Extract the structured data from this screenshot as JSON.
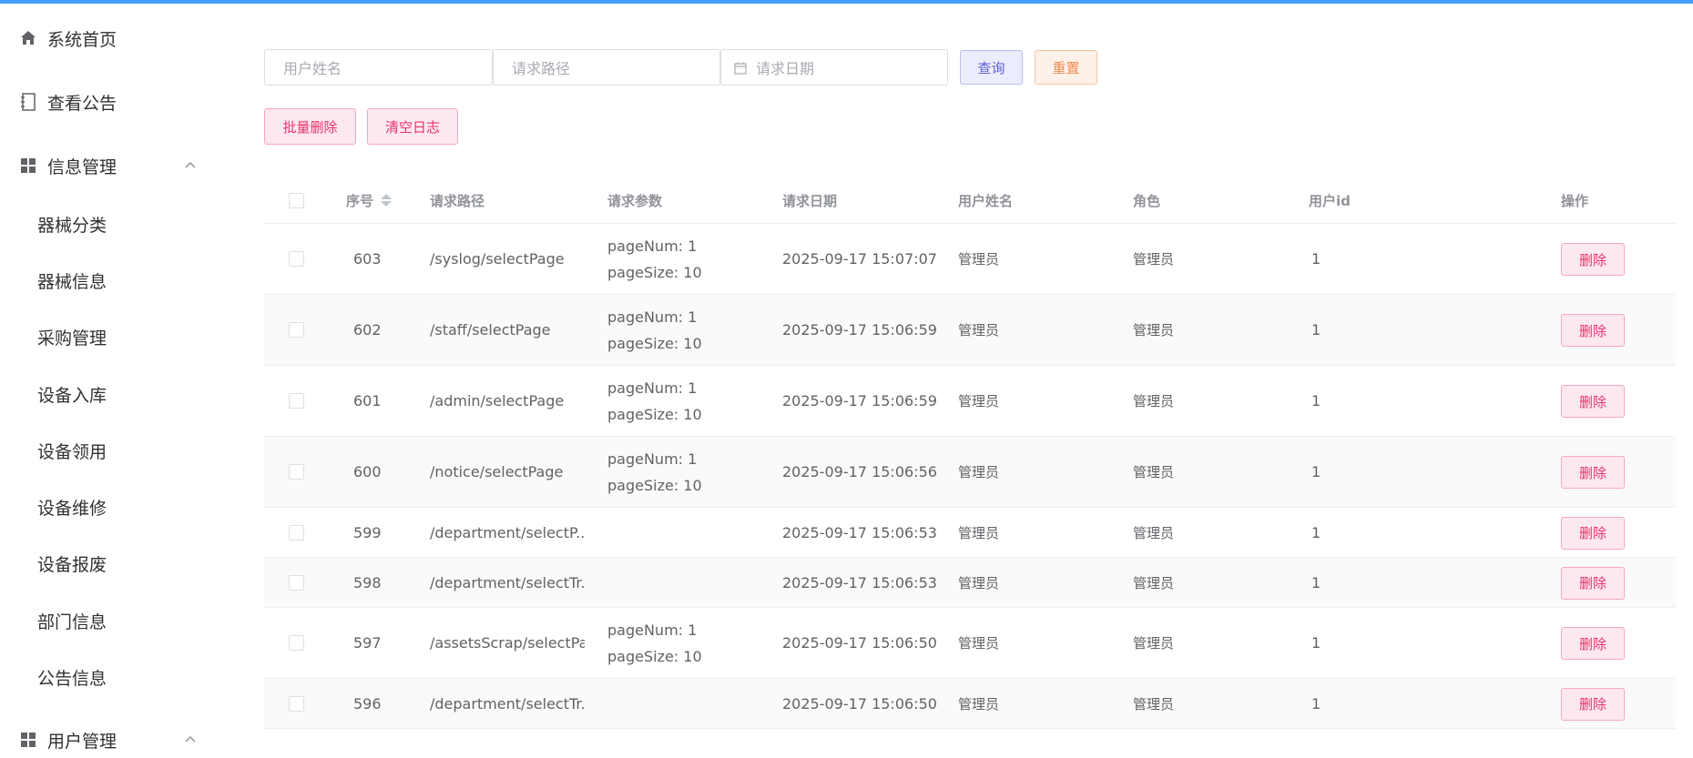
{
  "colors": {
    "accent": "#409eff",
    "danger": "#e8336a",
    "query": "#5b5fd6",
    "reset": "#f08a4b"
  },
  "sidebar": {
    "items": [
      {
        "label": "系统首页",
        "icon": "home-icon"
      },
      {
        "label": "查看公告",
        "icon": "notebook-icon"
      },
      {
        "label": "信息管理",
        "icon": "grid-icon"
      },
      {
        "label": "用户管理",
        "icon": "grid-icon"
      }
    ],
    "sub_items": [
      "器械分类",
      "器械信息",
      "采购管理",
      "设备入库",
      "设备领用",
      "设备维修",
      "设备报废",
      "部门信息",
      "公告信息"
    ]
  },
  "search": {
    "username_placeholder": "用户姓名",
    "path_placeholder": "请求路径",
    "date_placeholder": "请求日期",
    "query_label": "查询",
    "reset_label": "重置"
  },
  "actions": {
    "batch_delete_label": "批量删除",
    "clear_log_label": "清空日志"
  },
  "table": {
    "headers": [
      "序号",
      "请求路径",
      "请求参数",
      "请求日期",
      "用户姓名",
      "角色",
      "用户id",
      "操作"
    ],
    "delete_label": "删除",
    "rows": [
      {
        "id": "603",
        "path": "/syslog/selectPage",
        "p1": "pageNum: 1",
        "p2": "pageSize: 10",
        "date": "2025-09-17 15:07:07",
        "user": "管理员",
        "role": "管理员",
        "uid": "1"
      },
      {
        "id": "602",
        "path": "/staff/selectPage",
        "p1": "pageNum: 1",
        "p2": "pageSize: 10",
        "date": "2025-09-17 15:06:59",
        "user": "管理员",
        "role": "管理员",
        "uid": "1"
      },
      {
        "id": "601",
        "path": "/admin/selectPage",
        "p1": "pageNum: 1",
        "p2": "pageSize: 10",
        "date": "2025-09-17 15:06:59",
        "user": "管理员",
        "role": "管理员",
        "uid": "1"
      },
      {
        "id": "600",
        "path": "/notice/selectPage",
        "p1": "pageNum: 1",
        "p2": "pageSize: 10",
        "date": "2025-09-17 15:06:56",
        "user": "管理员",
        "role": "管理员",
        "uid": "1"
      },
      {
        "id": "599",
        "path": "/department/selectP...",
        "p1": "",
        "p2": "",
        "date": "2025-09-17 15:06:53",
        "user": "管理员",
        "role": "管理员",
        "uid": "1"
      },
      {
        "id": "598",
        "path": "/department/selectTr...",
        "p1": "",
        "p2": "",
        "date": "2025-09-17 15:06:53",
        "user": "管理员",
        "role": "管理员",
        "uid": "1"
      },
      {
        "id": "597",
        "path": "/assetsScrap/selectPa...",
        "p1": "pageNum: 1",
        "p2": "pageSize: 10",
        "date": "2025-09-17 15:06:50",
        "user": "管理员",
        "role": "管理员",
        "uid": "1"
      },
      {
        "id": "596",
        "path": "/department/selectTr...",
        "p1": "",
        "p2": "",
        "date": "2025-09-17 15:06:50",
        "user": "管理员",
        "role": "管理员",
        "uid": "1"
      }
    ]
  }
}
